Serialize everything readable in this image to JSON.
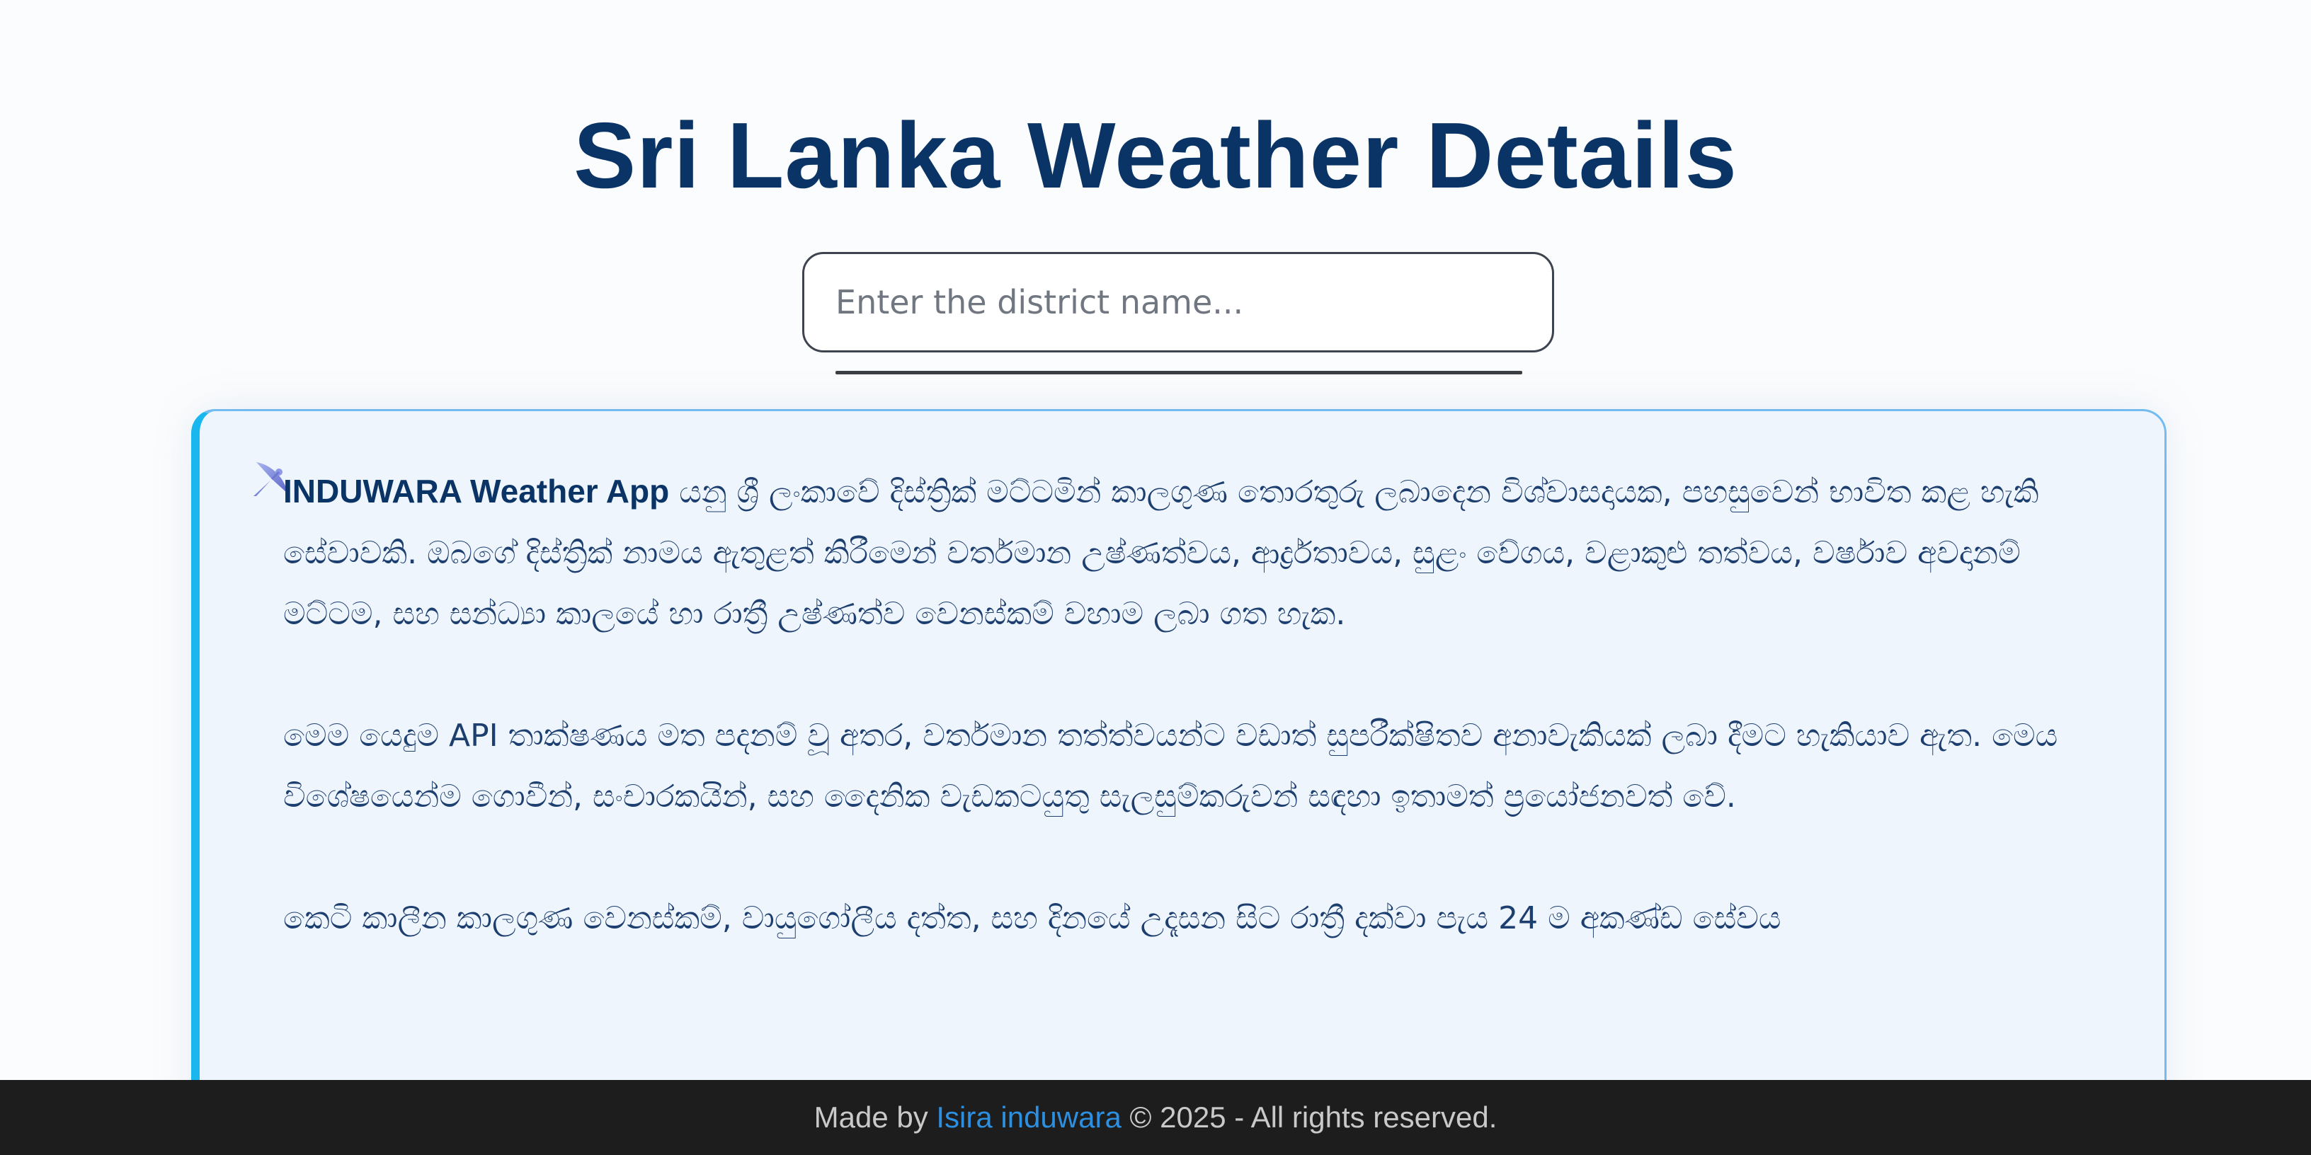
{
  "header": {
    "title": "Sri Lanka Weather Details"
  },
  "search": {
    "placeholder": "Enter the district name...",
    "value": ""
  },
  "info_card": {
    "icon": "satellite-dish-icon",
    "app_name": "INDUWARA Weather App",
    "para1_rest": " යනු ශ්‍රී ලංකාවේ දිස්ත්‍රික් මට්ටමින් කාලගුණ තොරතුරු ලබාදෙන විශ්වාසදායක, පහසුවෙන් භාවිත කළ හැකි සේවාවකි. ඔබගේ දිස්ත්‍රික් නාමය ඇතුළත් කිරීමෙන් වර්තමාන උෂ්ණත්වය, ආර්ද්‍රතාවය, සුළං වේගය, වළාකුළු තත්වය, වර්ෂාව අවදානම් මට්ටම, සහ සන්ධ්‍යා කාලයේ හා රාත්‍රී උෂ්ණත්ව වෙනස්කම් වහාම ලබා ගත හැක.",
    "para2": "මෙම යෙදුම API තාක්ෂණය මත පදනම් වූ අතර, වර්තමාන තත්ත්වයන්ට වඩාත් සුපරීක්ෂිතව අනාවැකියක් ලබා දීමට හැකියාව ඇත. මෙය විශේෂයෙන්ම ගොවීන්, සංචාරකයින්, සහ දෛනික වැඩකටයුතු සැලසුම්කරුවන් සඳහා ඉතාමත් ප්‍රයෝජනවත් වේ.",
    "para3": "කෙටි කාලීන කාලගුණ වෙනස්කම්, වායුගෝලීය දත්ත, සහ දිනයේ උදෑසන සිට රාත්‍රී දක්වා පැය 24 ම අකණ්ඩ සේවය"
  },
  "footer": {
    "prefix": "Made by ",
    "author": "Isira induwara",
    "suffix": " © 2025 - All rights reserved."
  },
  "colors": {
    "title": "#0b3466",
    "card_bg": "#eff5fc",
    "card_accent": "#19b7ee",
    "footer_bg": "#1d1d1d",
    "link": "#2c8fe0"
  }
}
